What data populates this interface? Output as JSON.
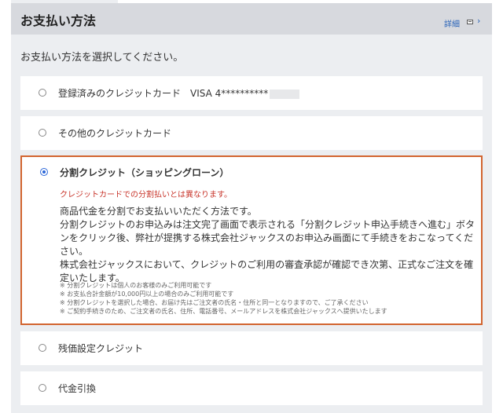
{
  "header": {
    "title": "お支払い方法",
    "detail_label": "詳細",
    "chevron": "›"
  },
  "instruction": "お支払い方法を選択してください。",
  "options": [
    {
      "label": "登録済みのクレジットカード　VISA 4**********",
      "selected": false
    },
    {
      "label": "その他のクレジットカード",
      "selected": false
    },
    {
      "label": "分割クレジット（ショッピングローン）",
      "selected": true,
      "warning": "クレジットカードでの分割払いとは異なります。",
      "description": [
        "商品代金を分割でお支払いいただく方法です。",
        "分割クレジットのお申込みは注文完了画面で表示される「分割クレジット申込手続きへ進む」ボタンをクリック後、弊社が提携する株式会社ジャックスのお申込み画面にて手続きをおこなってください。",
        "株式会社ジャックスにおいて、クレジットのご利用の審査承認が確認でき次第、正式なご注文を確定いたします。"
      ],
      "notes": [
        "※ 分割クレジットは個人のお客様のみご利用可能です",
        "※ お支払合計金額が10,000円以上の場合のみご利用可能です",
        "※ 分割クレジットを選択した場合、お届け先はご注文者の氏名・住所と同一となりますので、ご了承ください",
        "※ ご契約手続きのため、ご注文者の氏名、住所、電話番号、メールアドレスを株式会社ジャックスへ提供いたします"
      ]
    },
    {
      "label": "残価設定クレジット",
      "selected": false
    },
    {
      "label": "代金引換",
      "selected": false
    }
  ],
  "colors": {
    "accent": "#2c67d8",
    "selected_border": "#d2642f",
    "warning": "#c8352b",
    "link": "#2a64b8"
  }
}
